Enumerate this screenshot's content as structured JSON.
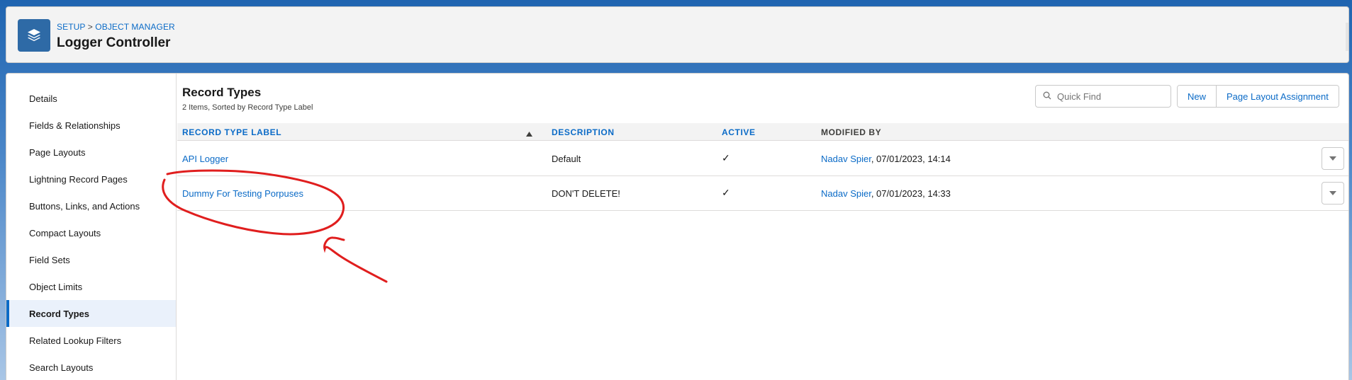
{
  "header": {
    "breadcrumb": {
      "setup": "SETUP",
      "separator": ">",
      "object_manager": "OBJECT MANAGER"
    },
    "title": "Logger Controller",
    "icon": "layers-icon"
  },
  "sidebar": {
    "items": [
      {
        "label": "Details"
      },
      {
        "label": "Fields & Relationships"
      },
      {
        "label": "Page Layouts"
      },
      {
        "label": "Lightning Record Pages"
      },
      {
        "label": "Buttons, Links, and Actions"
      },
      {
        "label": "Compact Layouts"
      },
      {
        "label": "Field Sets"
      },
      {
        "label": "Object Limits"
      },
      {
        "label": "Record Types"
      },
      {
        "label": "Related Lookup Filters"
      },
      {
        "label": "Search Layouts"
      }
    ],
    "active": "Record Types"
  },
  "main": {
    "title": "Record Types",
    "subtitle": "2 Items, Sorted by Record Type Label",
    "search": {
      "placeholder": "Quick Find",
      "value": ""
    },
    "buttons": {
      "new": "New",
      "page_layout_assignment": "Page Layout Assignment"
    },
    "columns": {
      "label": "Record Type Label",
      "description": "Description",
      "active": "Active",
      "modified_by": "Modified By"
    },
    "rows": [
      {
        "label": "API Logger",
        "description": "Default",
        "active": "✓",
        "user": "Nadav Spier",
        "date": ", 07/01/2023, 14:14"
      },
      {
        "label": "Dummy For Testing Porpuses",
        "description": "DON'T DELETE!",
        "active": "✓",
        "user": "Nadav Spier",
        "date": ", 07/01/2023, 14:33"
      }
    ]
  },
  "colors": {
    "accent": "#0b6bc7",
    "brand_blue": "#1b5fa8",
    "annotation_red": "#e01e1e"
  }
}
